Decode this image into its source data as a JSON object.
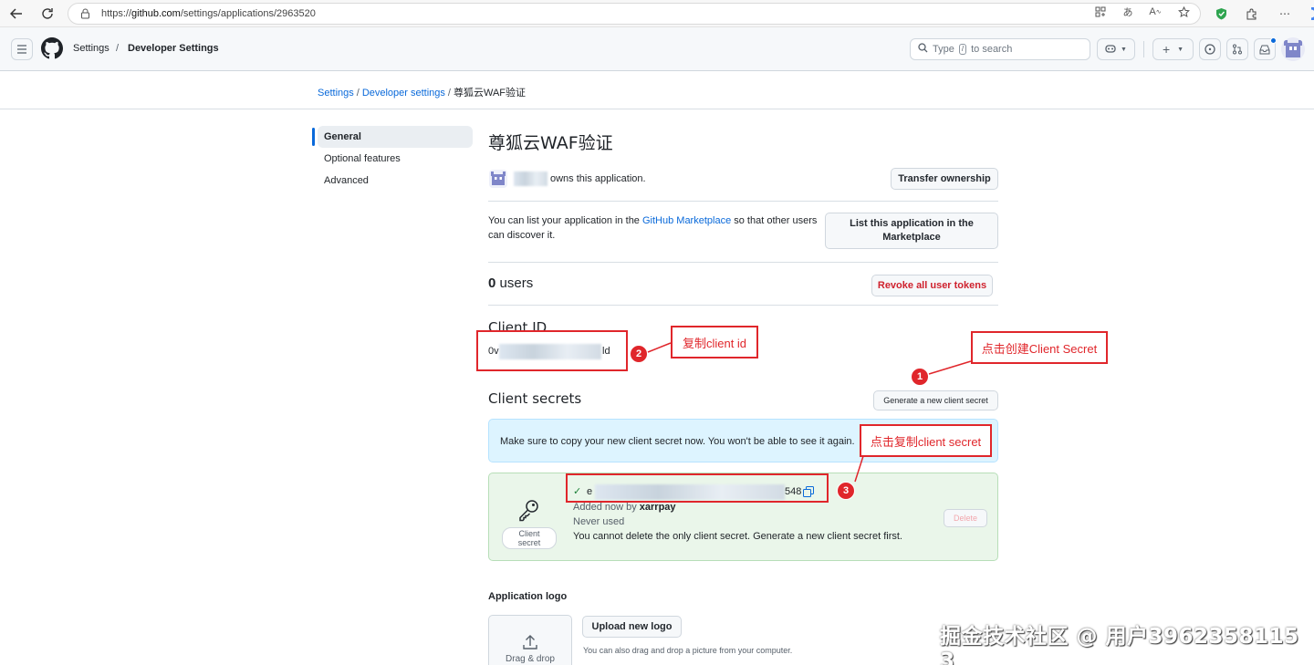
{
  "browser": {
    "url_prefix": "https://",
    "url_host": "github.com",
    "url_path": "/settings/applications/2963520"
  },
  "header": {
    "settings": "Settings",
    "sep": "/",
    "developer_settings": "Developer Settings",
    "search_pre": "Type",
    "search_key": "/",
    "search_post": "to search"
  },
  "breadcrumb": {
    "items": [
      "Settings",
      "Developer settings"
    ],
    "current": "尊狐云WAF验证"
  },
  "sidebar": {
    "items": [
      {
        "label": "General"
      },
      {
        "label": "Optional features"
      },
      {
        "label": "Advanced"
      }
    ]
  },
  "app": {
    "title": "尊狐云WAF验证",
    "owns_text": "owns this application.",
    "transfer_btn": "Transfer ownership",
    "marketplace_text_1": "You can list your application in the ",
    "marketplace_link": "GitHub Marketplace",
    "marketplace_text_2": " so that other users can discover it.",
    "marketplace_btn": "List this application in the Marketplace",
    "users_count": "0",
    "users_label": "users",
    "revoke_btn": "Revoke all user tokens",
    "client_id_label": "Client ID",
    "client_id_start": "0v",
    "client_id_end": "ld",
    "client_secrets_label": "Client secrets",
    "generate_btn": "Generate a new client secret",
    "flash_text": "Make sure to copy your new client secret now. You won't be able to see it again.",
    "secret_start": "e",
    "secret_end": "548",
    "check": "✓",
    "added_prefix": "Added now by ",
    "added_user": "xarrpay",
    "never_used": "Never used",
    "cannot_delete": "You cannot delete the only client secret. Generate a new client secret first.",
    "key_label": "Client secret",
    "delete_btn": "Delete",
    "logo_heading": "Application logo",
    "upload_btn": "Upload new logo",
    "drag_text": "Drag & drop",
    "drag_help": "You can also drag and drop a picture from your computer."
  },
  "annotations": {
    "copy_client_id": "复制client id",
    "create_secret": "点击创建Client Secret",
    "copy_secret": "点击复制client secret",
    "num1": "1",
    "num2": "2",
    "num3": "3"
  },
  "watermark": "掘金技术社区 @ 用户3962358115​3",
  "colors": {
    "accent": "#0969da",
    "danger": "#cf222e",
    "annotation": "#e0262b"
  }
}
